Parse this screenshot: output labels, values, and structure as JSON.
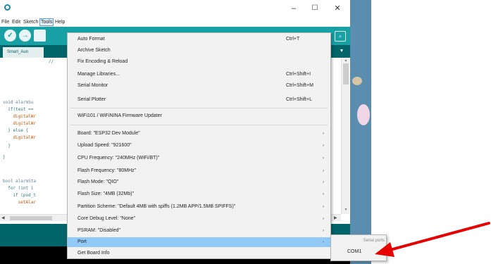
{
  "window": {
    "minimize": "–",
    "maximize": "☐",
    "close": "✕"
  },
  "menubar": {
    "items": [
      {
        "label": "File"
      },
      {
        "label": "Edit"
      },
      {
        "label": "Sketch"
      },
      {
        "label": "Tools"
      },
      {
        "label": "Help"
      }
    ]
  },
  "editor": {
    "tab": "Smart_Aun",
    "code": [
      "                  //",
      "void alarmSu",
      "  if(test ==",
      "    digitalWr",
      "    digitalWr",
      "  } else {",
      "    digitalWr",
      "  }",
      "}",
      "bool alarmSta",
      "  for (int i",
      "    if (pod_t",
      "      setAlar"
    ]
  },
  "tools_menu": {
    "items": [
      {
        "label": "Auto Format",
        "shortcut": "Ctrl+T"
      },
      {
        "label": "Archive Sketch",
        "shortcut": ""
      },
      {
        "label": "Fix Encoding & Reload",
        "shortcut": ""
      },
      {
        "label": "Manage Libraries...",
        "shortcut": "Ctrl+Shift+I"
      },
      {
        "label": "Serial Monitor",
        "shortcut": "Ctrl+Shift+M"
      },
      {
        "label": "Serial Plotter",
        "shortcut": "Ctrl+Shift+L"
      },
      {
        "label": "WiFi101 / WiFiNINA Firmware Updater",
        "shortcut": ""
      },
      {
        "label": "Board: \"ESP32 Dev Module\"",
        "shortcut": ""
      },
      {
        "label": "Upload Speed: \"921600\"",
        "shortcut": ""
      },
      {
        "label": "CPU Frequency: \"240MHz (WiFi/BT)\"",
        "shortcut": ""
      },
      {
        "label": "Flash Frequency: \"80MHz\"",
        "shortcut": ""
      },
      {
        "label": "Flash Mode: \"QIO\"",
        "shortcut": ""
      },
      {
        "label": "Flash Size: \"4MB (32Mb)\"",
        "shortcut": ""
      },
      {
        "label": "Partition Scheme: \"Default 4MB with spiffs (1.2MB APP/1.5MB SPIFFS)\"",
        "shortcut": ""
      },
      {
        "label": "Core Debug Level: \"None\"",
        "shortcut": ""
      },
      {
        "label": "PSRAM: \"Disabled\"",
        "shortcut": ""
      },
      {
        "label": "Port",
        "shortcut": ""
      },
      {
        "label": "Get Board Info",
        "shortcut": ""
      }
    ]
  },
  "port_submenu": {
    "header": "Serial ports",
    "items": [
      {
        "label": "COM1"
      }
    ]
  },
  "colors": {
    "toolbar": "#17a1a5",
    "menu_highlight": "#91c9f7",
    "annotation_arrow": "#e60000"
  }
}
